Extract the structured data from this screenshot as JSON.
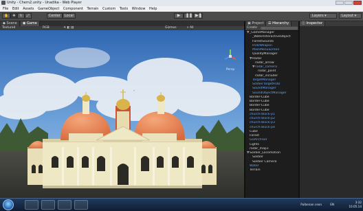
{
  "window": {
    "title": "Unity - Chern2.unity - Unadika - Web Player"
  },
  "menu": [
    "File",
    "Edit",
    "Assets",
    "GameObject",
    "Component",
    "Terrain",
    "Custom",
    "Tools",
    "Window",
    "Help"
  ],
  "toolbar": {
    "center_label": "Center",
    "local_label": "Local",
    "layers_label": "Layers",
    "layout_label": "Layout",
    "play_glyph": "▶",
    "pause_glyph": "❚❚",
    "step_glyph": "▶❚"
  },
  "game_tabs": {
    "scene": "Scene",
    "game": "Game"
  },
  "game_bar": {
    "aspect": "Free Aspect",
    "gizmos": "Gizmos",
    "stats_label": "Stats",
    "textured": "Textured",
    "rgb": "RGB"
  },
  "scene_gizmo": {
    "label": "Persp"
  },
  "hierarchy_tabs": {
    "project": "Project",
    "hierarchy": "Hierarchy"
  },
  "hierarchy_search": {
    "create": "Create",
    "placeholder": "All"
  },
  "inspector_tab": "Inspector",
  "hierarchy_items": [
    {
      "label": "_GameManager",
      "expanded": true,
      "blue": false
    },
    {
      "label": "_WaterInteractiveObject",
      "expanded": false,
      "blue": false
    },
    {
      "label": "ForestSounds",
      "expanded": false,
      "blue": false
    },
    {
      "label": "HUDWeapon",
      "expanded": false,
      "blue": true
    },
    {
      "label": "MainMenuScreen",
      "expanded": false,
      "blue": true
    },
    {
      "label": "QualityManager",
      "expanded": false,
      "blue": false
    },
    {
      "label": "Radar",
      "expanded": true,
      "blue": false
    },
    {
      "label": "radar_arrow",
      "expanded": false,
      "blue": false
    },
    {
      "label": "radar_camera",
      "expanded": true,
      "blue": true
    },
    {
      "label": "radar_point",
      "expanded": false,
      "blue": false
    },
    {
      "label": "radar_includer",
      "expanded": false,
      "blue": false
    },
    {
      "label": "TargetManager",
      "expanded": false,
      "blue": true
    },
    {
      "label": "SoldierTargetHUD",
      "expanded": false,
      "blue": true
    },
    {
      "label": "SoundManager",
      "expanded": false,
      "blue": true
    },
    {
      "label": "SoundObjectManager",
      "expanded": false,
      "blue": true
    },
    {
      "label": "Border-Cube",
      "expanded": false,
      "blue": false
    },
    {
      "label": "Border-Cube",
      "expanded": false,
      "blue": false
    },
    {
      "label": "Border-Cube",
      "expanded": false,
      "blue": false
    },
    {
      "label": "Border-Cube",
      "expanded": false,
      "blue": false
    },
    {
      "label": "church-block-p1",
      "expanded": false,
      "blue": true
    },
    {
      "label": "church-block-p2",
      "expanded": false,
      "blue": true
    },
    {
      "label": "church-block-p3",
      "expanded": false,
      "blue": true
    },
    {
      "label": "church-block-p4",
      "expanded": false,
      "blue": true
    },
    {
      "label": "Cube",
      "expanded": false,
      "blue": false
    },
    {
      "label": "Forest",
      "expanded": false,
      "blue": false
    },
    {
      "label": "GOArchFall",
      "expanded": false,
      "blue": true
    },
    {
      "label": "Lights",
      "expanded": false,
      "blue": false
    },
    {
      "label": "radar_map1",
      "expanded": false,
      "blue": false
    },
    {
      "label": "Soldier_Locomotion",
      "expanded": true,
      "blue": false
    },
    {
      "label": "Soldier",
      "expanded": false,
      "blue": false
    },
    {
      "label": "Soldier Camera",
      "expanded": false,
      "blue": false
    },
    {
      "label": "Water",
      "expanded": false,
      "blue": true
    },
    {
      "label": "Terrain",
      "expanded": false,
      "blue": false
    }
  ],
  "taskbar": {
    "clock_time": "3:32",
    "clock_date": "10.05.14",
    "language": "EN",
    "notify_label": "Pulbenan ceon"
  },
  "colors": {
    "hierarchy_blue": "#6ea0e8",
    "church_wall": "#efe8c4",
    "church_roof": "#e87a48",
    "gold": "#d8b44a"
  }
}
